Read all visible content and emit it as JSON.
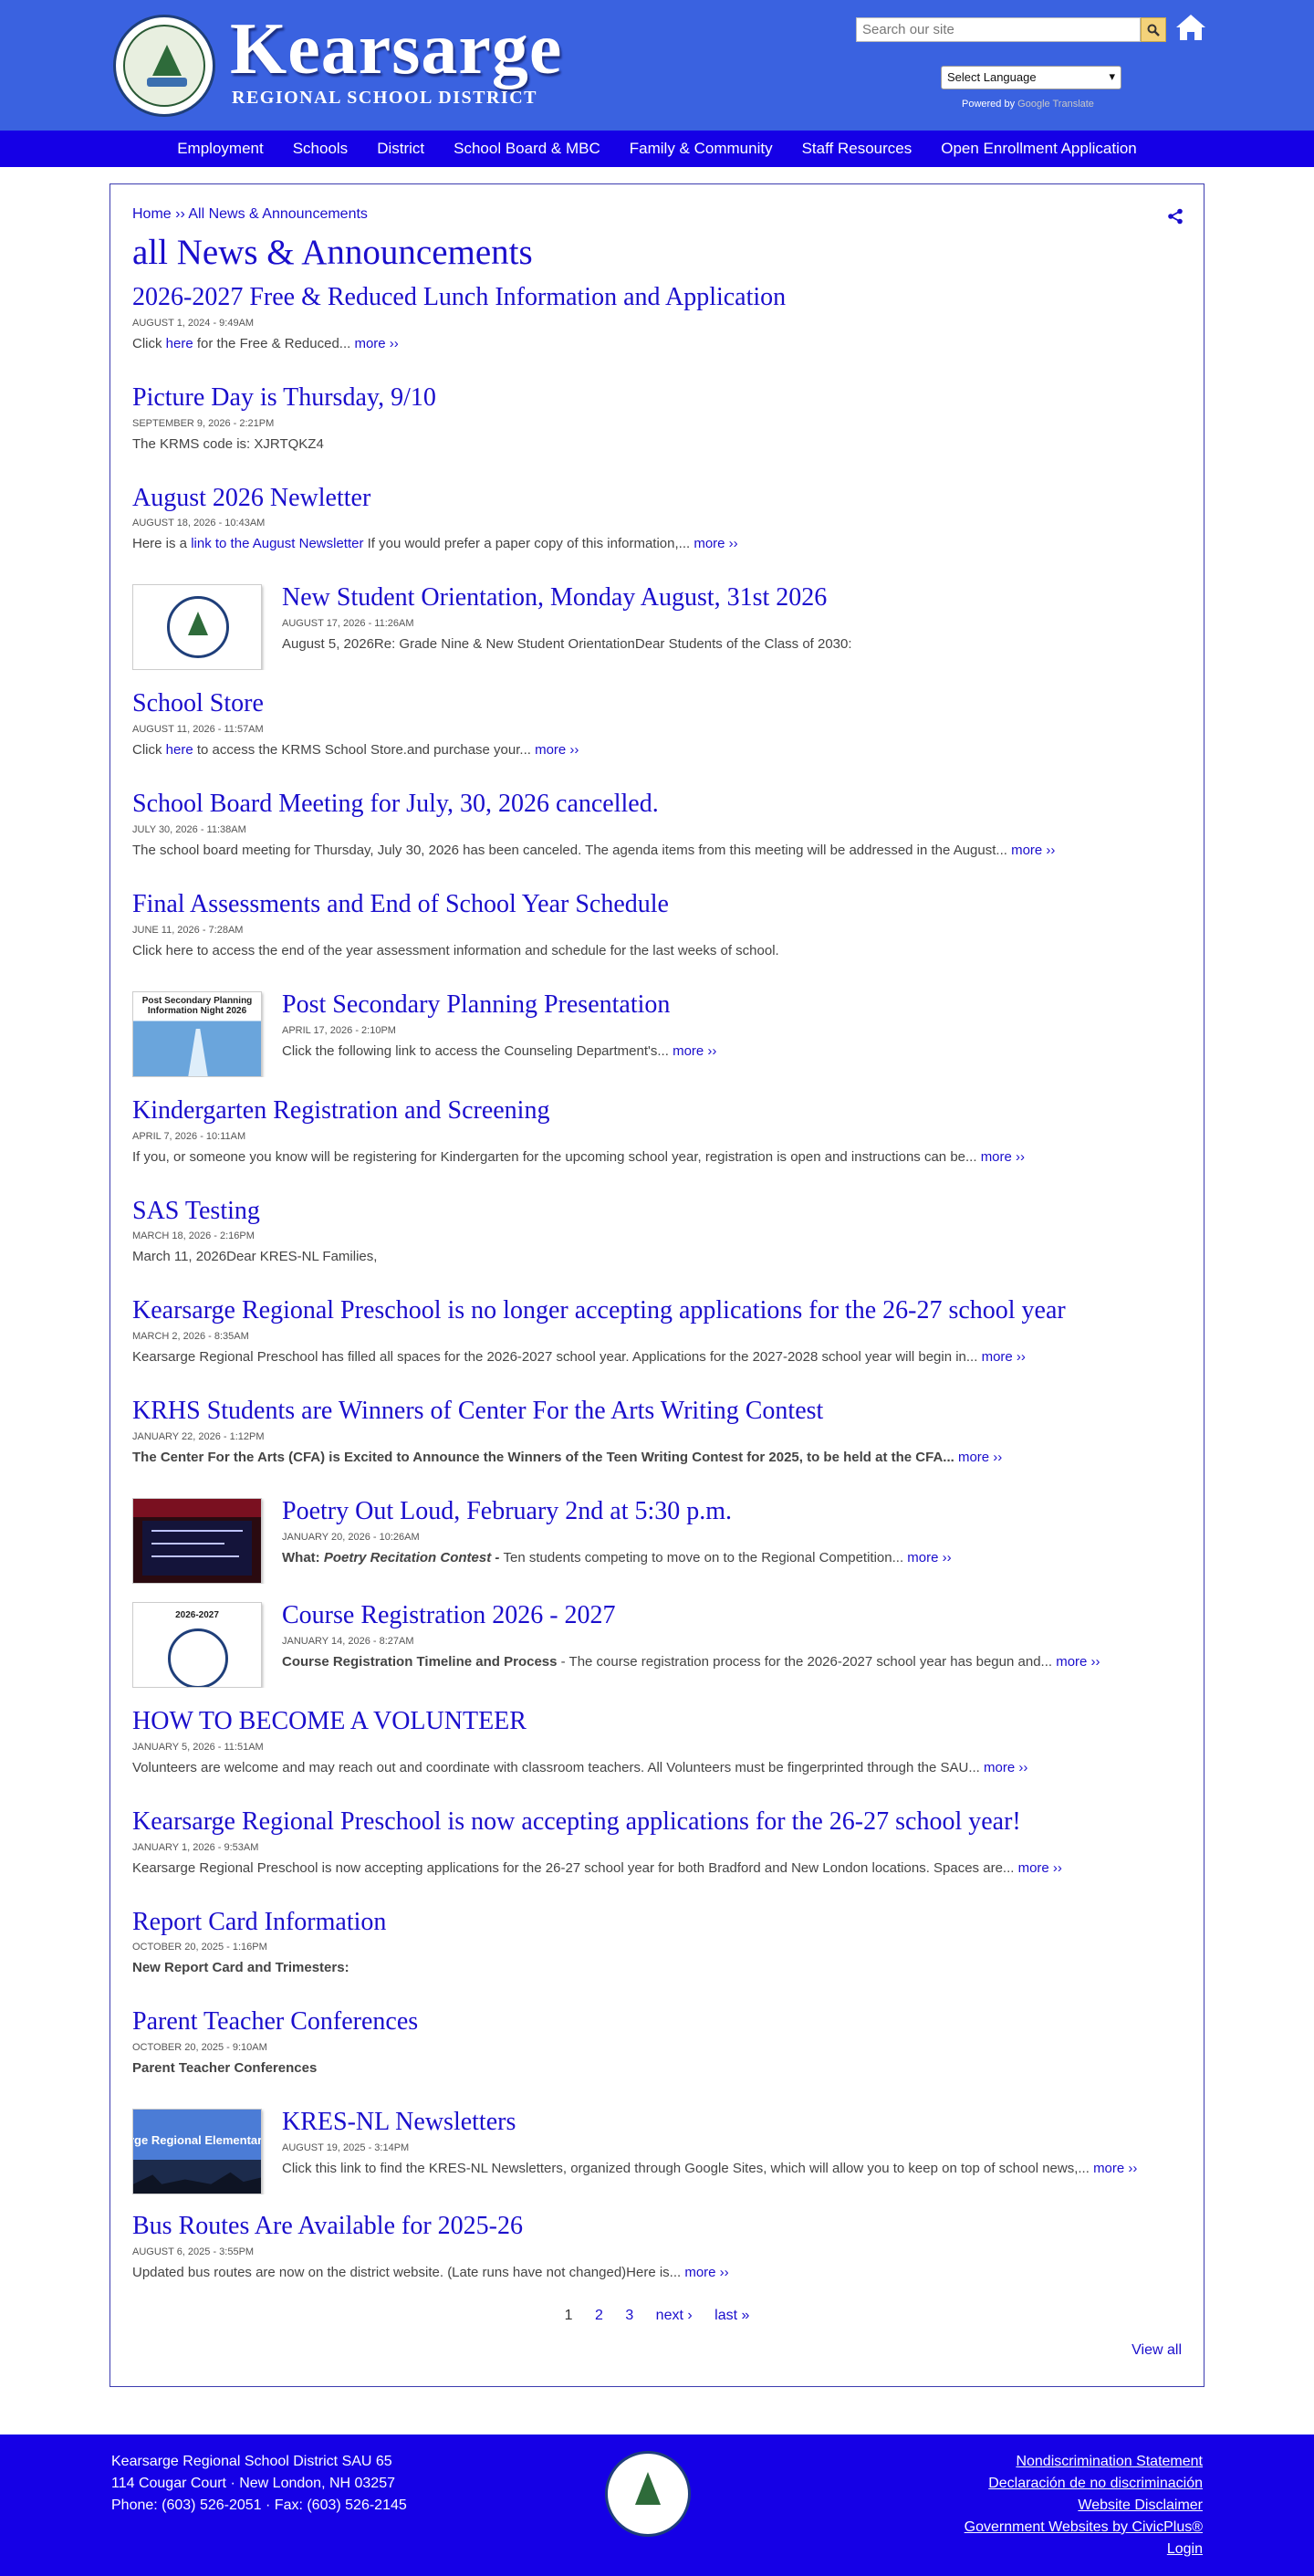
{
  "header": {
    "brand_name": "Kearsarge",
    "brand_sub": "REGIONAL SCHOOL DISTRICT",
    "search_placeholder": "Search our site",
    "language_select": "Select Language",
    "powered_prefix": "Powered by ",
    "powered_brand": "Google Translate"
  },
  "nav": {
    "items": [
      "Employment",
      "Schools",
      "District",
      "School Board & MBC",
      "Family & Community",
      "Staff Resources",
      "Open Enrollment Application"
    ]
  },
  "breadcrumb": {
    "home": "Home",
    "sep": " ›› ",
    "current": "All News & Announcements"
  },
  "page_title": "all News & Announcements",
  "news": [
    {
      "title": "2026-2027 Free & Reduced Lunch Information and Application",
      "date": "AUGUST 1, 2024 - 9:49AM",
      "teaser_pre": "Click ",
      "teaser_link": "here",
      "teaser_post": " for the Free & Reduced...",
      "more": "more ››"
    },
    {
      "title": "Picture Day is Thursday, 9/10",
      "date": "SEPTEMBER 9, 2026 - 2:21PM",
      "teaser": "The KRMS code is:  XJRTQKZ4"
    },
    {
      "title": "August 2026 Newletter",
      "date": "AUGUST 18, 2026 - 10:43AM",
      "teaser_pre": "Here is a ",
      "teaser_link": "link to the August Newsletter",
      "teaser_post": " If you would prefer a paper copy of this information,...",
      "more": "more ››"
    },
    {
      "title": "New Student Orientation, Monday August, 31st 2026",
      "date": "AUGUST 17, 2026 - 11:26AM",
      "teaser": "August 5, 2026Re: Grade Nine & New Student OrientationDear Students of the Class of 2030:"
    },
    {
      "title": "School Store",
      "date": "AUGUST 11, 2026 - 11:57AM",
      "teaser_pre": "Click ",
      "teaser_link": "here",
      "teaser_post": " to access the KRMS School Store.and purchase your...",
      "more": "more ››"
    },
    {
      "title": "School Board Meeting for July, 30, 2026 cancelled.",
      "date": "JULY 30, 2026 - 11:38AM",
      "teaser": "The school board meeting for Thursday, July 30, 2026 has been canceled.  The agenda items from this meeting will be addressed in the August...",
      "more": "more ››"
    },
    {
      "title": "Final Assessments and End of School Year Schedule",
      "date": "JUNE 11, 2026 - 7:28AM",
      "teaser": "Click here to access the end of the year assessment information and schedule for the last weeks of school."
    },
    {
      "title": "Post Secondary Planning Presentation",
      "date": "APRIL 17, 2026 - 2:10PM",
      "teaser": "Click the following link to access the Counseling Department's...",
      "more": "more ››",
      "thumb_caption": "Post Secondary Planning Information Night 2026"
    },
    {
      "title": "Kindergarten Registration and Screening",
      "date": "APRIL 7, 2026 - 10:11AM",
      "teaser": "If you, or someone you know will be registering for Kindergarten for the upcoming school year, registration is open and instructions can be...",
      "more": "more ››"
    },
    {
      "title": "SAS Testing",
      "date": "MARCH 18, 2026 - 2:16PM",
      "teaser": "March 11, 2026Dear KRES-NL Families,"
    },
    {
      "title": "Kearsarge Regional Preschool is no longer accepting applications for the 26-27 school year",
      "date": "MARCH 2, 2026 - 8:35AM",
      "teaser": "Kearsarge Regional Preschool has filled all spaces for the 2026-2027 school year. Applications for the 2027-2028 school year will begin in...",
      "more": "more ››"
    },
    {
      "title": "KRHS Students are Winners of Center For the Arts Writing Contest",
      "date": "JANUARY 22, 2026 - 1:12PM",
      "teaser_bold": " The Center For the Arts (CFA) is Excited to Announce the Winners of the Teen Writing Contest for 2025, to be held at the CFA...",
      "more": "more ››"
    },
    {
      "title": "Poetry Out Loud, February 2nd at 5:30 p.m.",
      "date": "JANUARY 20, 2026 - 10:26AM",
      "teaser_bold": "What: ",
      "teaser_italic": "Poetry Recitation Contest - ",
      "teaser_post": "Ten students competing to move on to the Regional Competition...",
      "more": "more ››"
    },
    {
      "title": "Course Registration 2026 - 2027",
      "date": "JANUARY 14, 2026 - 8:27AM",
      "teaser_bold": "Course Registration Timeline and Process",
      "teaser_post": " - The course registration process for the 2026-2027 school year has begun and...",
      "more": "more ››",
      "thumb_caption": "2026-2027"
    },
    {
      "title": "HOW TO BECOME A VOLUNTEER",
      "date": "JANUARY 5, 2026 - 11:51AM",
      "teaser": "Volunteers are welcome and may reach out and coordinate with classroom teachers. All Volunteers must be fingerprinted through the SAU...",
      "more": "more ››"
    },
    {
      "title": "Kearsarge Regional Preschool is now accepting applications for the 26-27 school year!",
      "date": "JANUARY 1, 2026 - 9:53AM",
      "teaser": "Kearsarge Regional Preschool is now accepting applications for the 26-27 school year for both Bradford and New London locations. Spaces are...",
      "more": "more ››"
    },
    {
      "title": "Report Card Information",
      "date": "OCTOBER 20, 2025 - 1:16PM",
      "teaser_bold": "New Report Card and Trimesters:"
    },
    {
      "title": "Parent Teacher Conferences",
      "date": "OCTOBER 20, 2025 - 9:10AM",
      "teaser_bold": "Parent Teacher Conferences"
    },
    {
      "title": "KRES-NL Newsletters",
      "date": "AUGUST 19, 2025 - 3:14PM",
      "teaser": "Click this link to find the KRES-NL Newsletters, organized through Google Sites, which will allow you to keep on top of school news,...",
      "more": "more ››",
      "thumb_caption": "rge Regional Elementary S"
    },
    {
      "title": "Bus Routes Are Available for 2025-26",
      "date": "AUGUST 6, 2025 - 3:55PM",
      "teaser": "Updated bus routes are now on the district website.  (Late runs have not changed)Here is...",
      "more": "more ››"
    }
  ],
  "pager": {
    "pages": [
      "1",
      "2",
      "3"
    ],
    "next": "next ›",
    "last": "last »"
  },
  "view_all": "View all",
  "footer": {
    "line1": "Kearsarge Regional School District SAU 65",
    "line2": "114 Cougar Court · New London, NH 03257",
    "line3": "Phone: (603) 526-2051 · Fax: (603) 526-2145",
    "links": [
      "Nondiscrimination Statement",
      "Declaración de no discriminación",
      "Website Disclaimer",
      "Government Websites by CivicPlus®",
      "Login"
    ]
  },
  "colors": {
    "header_blue": "#3a62e0",
    "nav_blue": "#1500e6",
    "link_blue": "#1a0ecc"
  }
}
